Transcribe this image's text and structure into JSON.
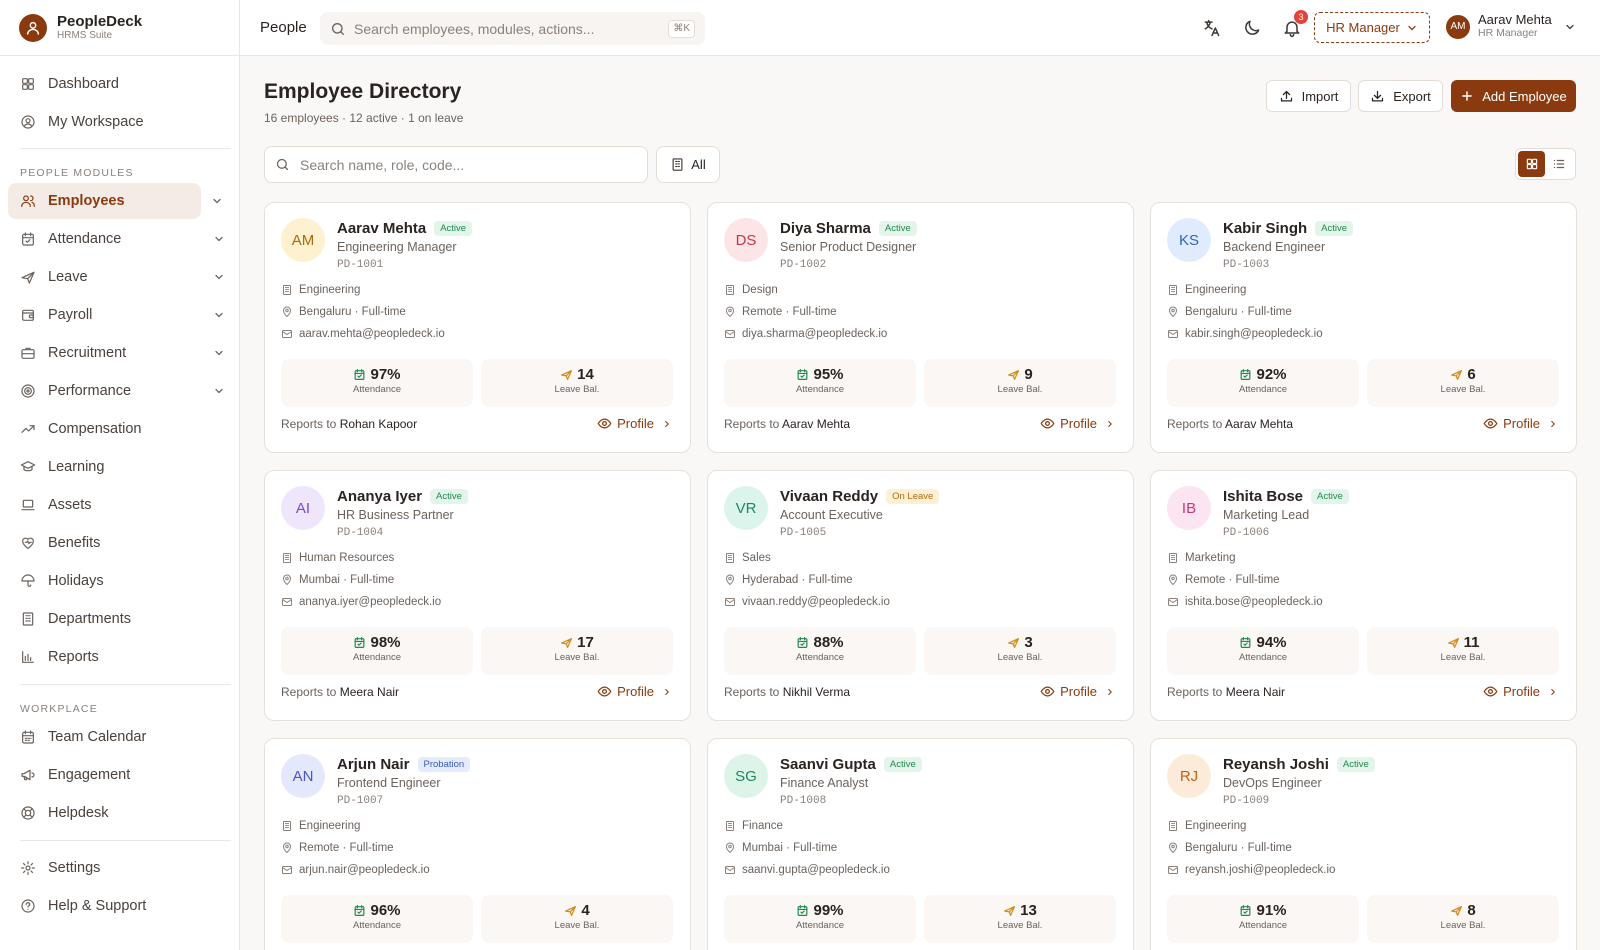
{
  "brand": {
    "name": "PeopleDeck",
    "subtitle": "HRMS Suite"
  },
  "sidebar": {
    "top": [
      {
        "label": "Dashboard",
        "icon": "grid-icon"
      },
      {
        "label": "My Workspace",
        "icon": "user-circle-icon"
      }
    ],
    "modules_label": "PEOPLE MODULES",
    "modules": [
      {
        "label": "Employees",
        "icon": "users-icon",
        "active": true,
        "expandable": true
      },
      {
        "label": "Attendance",
        "icon": "calendar-check-icon",
        "expandable": true
      },
      {
        "label": "Leave",
        "icon": "plane-icon",
        "expandable": true
      },
      {
        "label": "Payroll",
        "icon": "wallet-icon",
        "expandable": true
      },
      {
        "label": "Recruitment",
        "icon": "briefcase-icon",
        "expandable": true
      },
      {
        "label": "Performance",
        "icon": "target-icon",
        "expandable": true
      },
      {
        "label": "Compensation",
        "icon": "trend-icon"
      },
      {
        "label": "Learning",
        "icon": "graduation-cap-icon"
      },
      {
        "label": "Assets",
        "icon": "laptop-icon"
      },
      {
        "label": "Benefits",
        "icon": "heart-icon"
      },
      {
        "label": "Holidays",
        "icon": "umbrella-icon"
      },
      {
        "label": "Departments",
        "icon": "building-icon"
      },
      {
        "label": "Reports",
        "icon": "bar-chart-icon"
      }
    ],
    "workplace_label": "WORKPLACE",
    "workplace": [
      {
        "label": "Team Calendar",
        "icon": "calendar-icon"
      },
      {
        "label": "Engagement",
        "icon": "megaphone-icon"
      },
      {
        "label": "Helpdesk",
        "icon": "lifebuoy-icon"
      }
    ],
    "bottom": [
      {
        "label": "Settings",
        "icon": "gear-icon"
      },
      {
        "label": "Help & Support",
        "icon": "help-icon"
      }
    ]
  },
  "topbar": {
    "title": "People",
    "search_placeholder": "Search employees, modules, actions...",
    "shortcut": "⌘K",
    "notifications": "3",
    "role": "HR Manager",
    "user": {
      "initials": "AM",
      "name": "Aarav Mehta",
      "role": "HR Manager"
    }
  },
  "page": {
    "title": "Employee Directory",
    "subtitle": "16 employees · 12 active · 1 on leave",
    "import_label": "Import",
    "export_label": "Export",
    "add_label": "Add Employee",
    "search_placeholder": "Search name, role, code...",
    "filter_label": "All",
    "view": "grid"
  },
  "labels": {
    "attendance": "Attendance",
    "leave": "Leave Bal.",
    "reports_prefix": "Reports to",
    "profile": "Profile"
  },
  "colors": {
    "accent": "#8a3a0e",
    "active": "#1f8a4c",
    "leave": "#b86b0a",
    "probation": "#3a5bb8"
  },
  "employees": [
    {
      "initials": "AM",
      "name": "Aarav Mehta",
      "status": "Active",
      "role": "Engineering Manager",
      "code": "PD-1001",
      "dept": "Engineering",
      "location": "Bengaluru · Full-time",
      "email": "aarav.mehta@peopledeck.io",
      "attendance": "97%",
      "leave": "14",
      "manager": "Rohan Kapoor",
      "avatar_bg": "#fdf1cf",
      "avatar_fg": "#a86a0a"
    },
    {
      "initials": "DS",
      "name": "Diya Sharma",
      "status": "Active",
      "role": "Senior Product Designer",
      "code": "PD-1002",
      "dept": "Design",
      "location": "Remote · Full-time",
      "email": "diya.sharma@peopledeck.io",
      "attendance": "95%",
      "leave": "9",
      "manager": "Aarav Mehta",
      "avatar_bg": "#fde4e6",
      "avatar_fg": "#c23a48"
    },
    {
      "initials": "KS",
      "name": "Kabir Singh",
      "status": "Active",
      "role": "Backend Engineer",
      "code": "PD-1003",
      "dept": "Engineering",
      "location": "Bengaluru · Full-time",
      "email": "kabir.singh@peopledeck.io",
      "attendance": "92%",
      "leave": "6",
      "manager": "Aarav Mehta",
      "avatar_bg": "#e0ecfd",
      "avatar_fg": "#2f64c2"
    },
    {
      "initials": "AI",
      "name": "Ananya Iyer",
      "status": "Active",
      "role": "HR Business Partner",
      "code": "PD-1004",
      "dept": "Human Resources",
      "location": "Mumbai · Full-time",
      "email": "ananya.iyer@peopledeck.io",
      "attendance": "98%",
      "leave": "17",
      "manager": "Meera Nair",
      "avatar_bg": "#efe6fc",
      "avatar_fg": "#7a4ac4"
    },
    {
      "initials": "VR",
      "name": "Vivaan Reddy",
      "status": "On Leave",
      "role": "Account Executive",
      "code": "PD-1005",
      "dept": "Sales",
      "location": "Hyderabad · Full-time",
      "email": "vivaan.reddy@peopledeck.io",
      "attendance": "88%",
      "leave": "3",
      "manager": "Nikhil Verma",
      "avatar_bg": "#dcf5ec",
      "avatar_fg": "#1c8a5e"
    },
    {
      "initials": "IB",
      "name": "Ishita Bose",
      "status": "Active",
      "role": "Marketing Lead",
      "code": "PD-1006",
      "dept": "Marketing",
      "location": "Remote · Full-time",
      "email": "ishita.bose@peopledeck.io",
      "attendance": "94%",
      "leave": "11",
      "manager": "Meera Nair",
      "avatar_bg": "#fce4f0",
      "avatar_fg": "#c03a7e"
    },
    {
      "initials": "AN",
      "name": "Arjun Nair",
      "status": "Probation",
      "role": "Frontend Engineer",
      "code": "PD-1007",
      "dept": "Engineering",
      "location": "Remote · Full-time",
      "email": "arjun.nair@peopledeck.io",
      "attendance": "96%",
      "leave": "4",
      "manager": "",
      "avatar_bg": "#e4e8fc",
      "avatar_fg": "#4a54c2"
    },
    {
      "initials": "SG",
      "name": "Saanvi Gupta",
      "status": "Active",
      "role": "Finance Analyst",
      "code": "PD-1008",
      "dept": "Finance",
      "location": "Mumbai · Full-time",
      "email": "saanvi.gupta@peopledeck.io",
      "attendance": "99%",
      "leave": "13",
      "manager": "",
      "avatar_bg": "#dcf5e8",
      "avatar_fg": "#1c8a52"
    },
    {
      "initials": "RJ",
      "name": "Reyansh Joshi",
      "status": "Active",
      "role": "DevOps Engineer",
      "code": "PD-1009",
      "dept": "Engineering",
      "location": "Bengaluru · Full-time",
      "email": "reyansh.joshi@peopledeck.io",
      "attendance": "91%",
      "leave": "8",
      "manager": "",
      "avatar_bg": "#fdebd9",
      "avatar_fg": "#c2621a"
    }
  ]
}
